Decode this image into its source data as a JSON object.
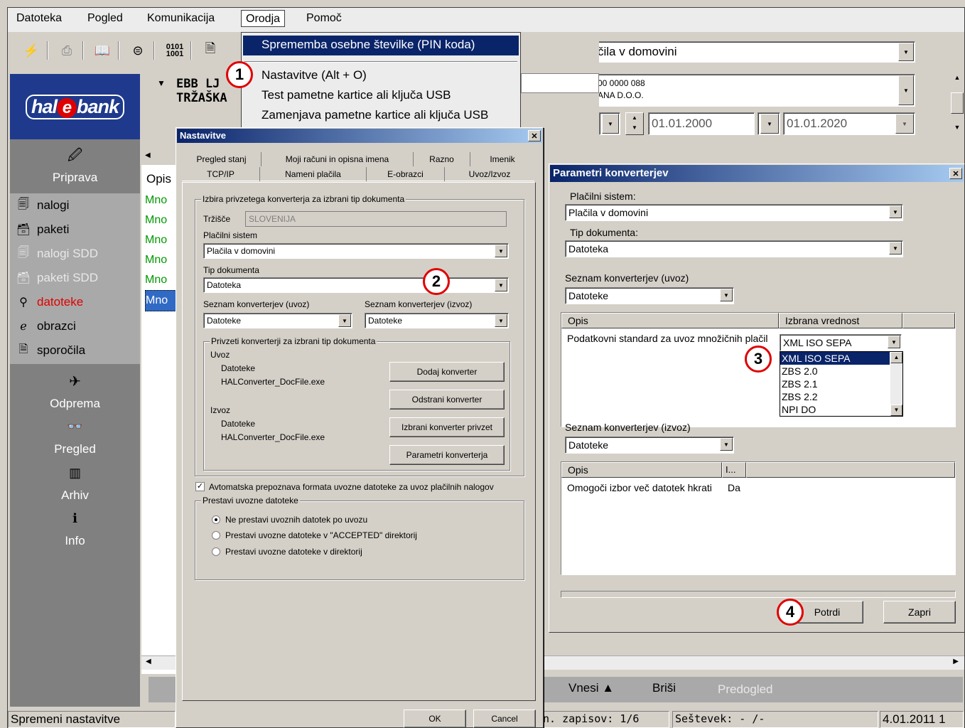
{
  "menubar": [
    "Datoteka",
    "Pogled",
    "Komunikacija",
    "Orodja",
    "Pomoč"
  ],
  "orodja_menu": [
    "Sprememba osebne številke (PIN koda)",
    "Nastavitve (Alt + O)",
    "Test pametne kartice ali ključa USB",
    "Zamenjava pametne kartice ali ključa USB"
  ],
  "main": {
    "payment_system_value": "čila v domovini",
    "account_line1": "00 0000 088",
    "account_line2": "ANA D.O.O.",
    "date_from": "01.01.2000",
    "date_to": "01.01.2020",
    "account_title1": "EBB LJ",
    "account_title2": "TRŽAŠKA",
    "list_header": "Opis",
    "list_rows": [
      "Mno",
      "Mno",
      "Mno",
      "Mno",
      "Mno",
      "Mno"
    ],
    "bottom_buttons": [
      "Vnesi ▲",
      "Briši",
      "Predogled"
    ]
  },
  "sidebar": {
    "logo": "hal e bank",
    "top_section": "Priprava",
    "items": [
      {
        "icon": "nalogi-icon",
        "label": "nalogi"
      },
      {
        "icon": "paketi-icon",
        "label": "paketi"
      },
      {
        "icon": "nalogi-sdd-icon",
        "label": "nalogi SDD"
      },
      {
        "icon": "paketi-sdd-icon",
        "label": "paketi SDD"
      },
      {
        "icon": "search-icon",
        "label": "datoteke"
      },
      {
        "icon": "obrazci-icon",
        "label": "obrazci"
      },
      {
        "icon": "sporocila-icon",
        "label": "sporočila"
      }
    ],
    "sections": [
      "Odprema",
      "Pregled",
      "Arhiv",
      "Info"
    ]
  },
  "status": {
    "left": "Spremeni nastavitve",
    "count": "n. zapisov: 1/6",
    "sum": "Seštevek: - /-",
    "date": "4.01.2011 1"
  },
  "nastavitve": {
    "title": "Nastavitve",
    "tabs_row1": [
      "Pregled stanj",
      "Moji računi in opisna imena",
      "Razno",
      "Imenik"
    ],
    "tabs_row2": [
      "TCP/IP",
      "Nameni plačila",
      "E-obrazci",
      "Uvoz/Izvoz"
    ],
    "group1_title": "Izbira privzetega konverterja za izbrani tip dokumenta",
    "trzisce_label": "Tržišče",
    "trzisce_value": "SLOVENIJA",
    "placilni_label": "Plačilni sistem",
    "placilni_value": "Plačila v domovini",
    "tip_label": "Tip dokumenta",
    "tip_value": "Datoteka",
    "uvoz_label": "Seznam konverterjev (uvoz)",
    "uvoz_value": "Datoteke",
    "izvoz_label": "Seznam konverterjev (izvoz)",
    "izvoz_value": "Datoteke",
    "group2_title": "Privzeti konverterji za izbrani tip dokumenta",
    "uvoz_heading": "Uvoz",
    "uvoz_item1": "Datoteke",
    "uvoz_item2": "HALConverter_DocFile.exe",
    "izvoz_heading": "Izvoz",
    "izvoz_item1": "Datoteke",
    "izvoz_item2": "HALConverter_DocFile.exe",
    "btn_dodaj": "Dodaj konverter",
    "btn_odstrani": "Odstrani konverter",
    "btn_izbrani": "Izbrani konverter privzet",
    "btn_parametri": "Parametri konverterja",
    "auto_check": "Avtomatska prepoznava formata uvozne datoteke za uvoz plačilnih nalogov",
    "group3_title": "Prestavi uvozne datoteke",
    "radio1": "Ne prestavi uvoznih datotek po uvozu",
    "radio2": "Prestavi uvozne datoteke v \"ACCEPTED\" direktorij",
    "radio3": "Prestavi uvozne datoteke v direktorij",
    "ok": "OK",
    "cancel": "Cancel"
  },
  "parametri": {
    "title": "Parametri konverterjev",
    "placilni_label": "Plačilni sistem:",
    "placilni_value": "Plačila v domovini",
    "tip_label": "Tip dokumenta:",
    "tip_value": "Datoteka",
    "uvoz_label": "Seznam konverterjev (uvoz)",
    "uvoz_value": "Datoteke",
    "grid1_col1": "Opis",
    "grid1_col2": "Izbrana vrednost",
    "grid1_row_desc": "Podatkovni standard za uvoz množičnih plačil",
    "grid1_row_value": "XML ISO SEPA",
    "dropdown_options": [
      "XML ISO SEPA",
      "ZBS 2.0",
      "ZBS 2.1",
      "ZBS 2.2",
      "NPI DO"
    ],
    "izvoz_label": "Seznam konverterjev (izvoz)",
    "izvoz_value": "Datoteke",
    "grid2_col1": "Opis",
    "grid2_col2": "I...",
    "grid2_row_desc": "Omogoči izbor več datotek hkrati",
    "grid2_row_value": "Da",
    "btn_potrdi": "Potrdi",
    "btn_zapri": "Zapri"
  },
  "callouts": [
    "1",
    "2",
    "3",
    "4"
  ]
}
